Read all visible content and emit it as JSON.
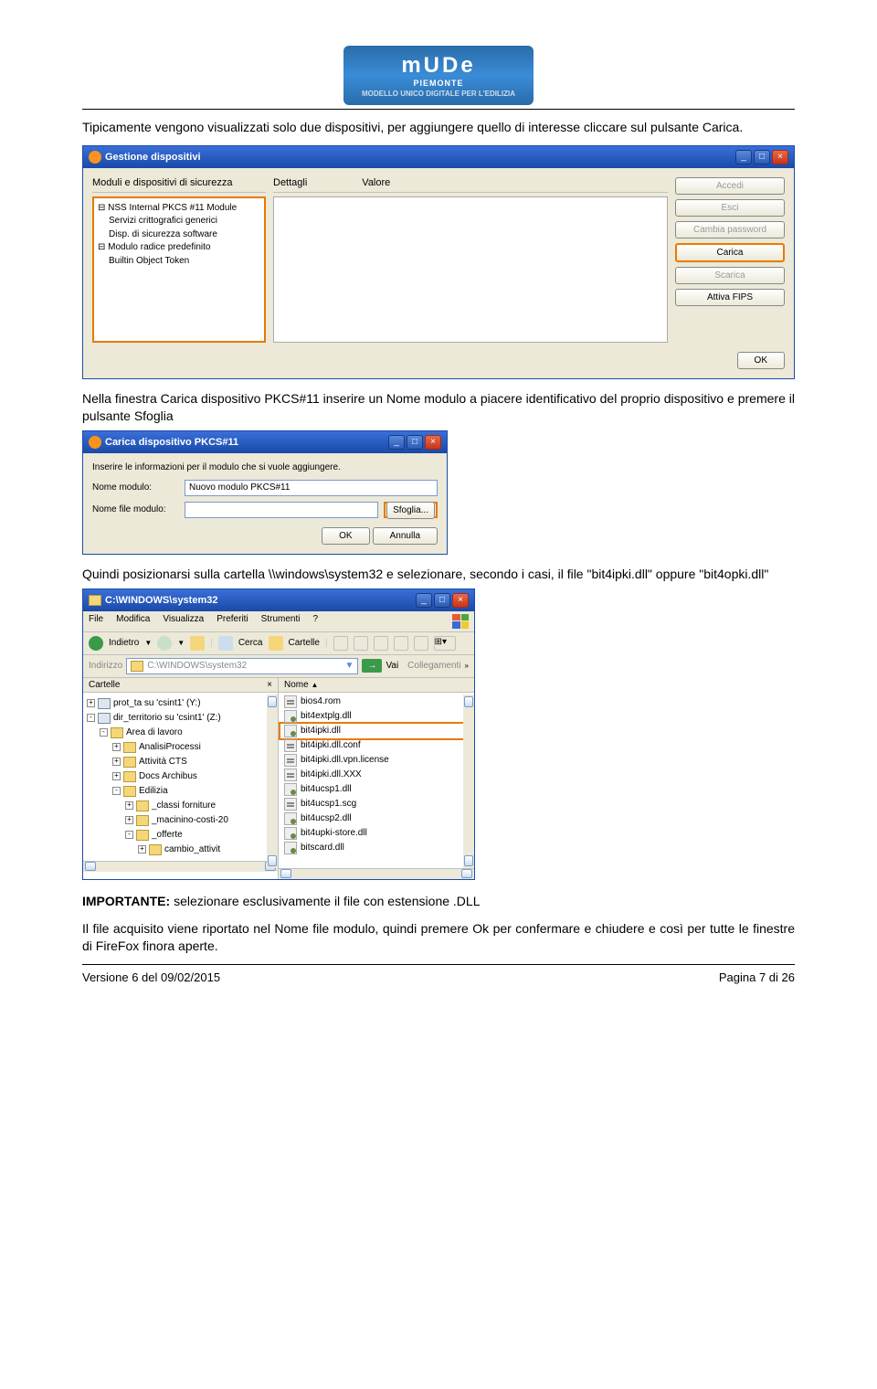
{
  "header": {
    "logo_main": "mUDe",
    "logo_sub": "PIEMONTE",
    "logo_tag": "MODELLO UNICO DIGITALE PER L'EDILIZIA"
  },
  "text1": "Tipicamente vengono visualizzati solo due dispositivi, per aggiungere quello di interesse cliccare sul pulsante Carica.",
  "win1": {
    "title": "Gestione dispositivi",
    "top_label": "Moduli e dispositivi di sicurezza",
    "columns": {
      "detail": "Dettagli",
      "value": "Valore"
    },
    "tree": [
      "⊟ NSS Internal PKCS #11 Module",
      "    Servizi crittografici generici",
      "    Disp. di sicurezza software",
      "⊟ Modulo radice predefinito",
      "    Builtin Object Token"
    ],
    "buttons": {
      "accedi": "Accedi",
      "esci": "Esci",
      "cambia": "Cambia password",
      "carica": "Carica",
      "scarica": "Scarica",
      "fips": "Attiva FIPS",
      "ok": "OK"
    }
  },
  "text2": "Nella finestra Carica dispositivo PKCS#11 inserire un Nome modulo a piacere identificativo del proprio dispositivo e premere il pulsante Sfoglia",
  "win2": {
    "title": "Carica dispositivo PKCS#11",
    "instruction": "Inserire le informazioni per il modulo che si vuole aggiungere.",
    "label_nome": "Nome modulo:",
    "value_nome": "Nuovo modulo PKCS#11",
    "label_file": "Nome file modulo:",
    "value_file": "",
    "sfoglia": "Sfoglia...",
    "ok": "OK",
    "annulla": "Annulla"
  },
  "text3": "Quindi posizionarsi sulla cartella \\\\windows\\system32 e selezionare, secondo i casi, il file \"bit4ipki.dll\" oppure \"bit4opki.dll\"",
  "win3": {
    "title": "C:\\WINDOWS\\system32",
    "menu": [
      "File",
      "Modifica",
      "Visualizza",
      "Preferiti",
      "Strumenti",
      "?"
    ],
    "toolbar": {
      "back": "Indietro",
      "search": "Cerca",
      "folders": "Cartelle"
    },
    "addr_label": "Indirizzo",
    "addr_value": "C:\\WINDOWS\\system32",
    "go": "Vai",
    "links": "Collegamenti",
    "side_title": "Cartelle",
    "side_close": "×",
    "tree": [
      {
        "indent": 0,
        "box": "+",
        "type": "drv",
        "label": "prot_ta su 'csint1' (Y:)"
      },
      {
        "indent": 0,
        "box": "-",
        "type": "drv",
        "label": "dir_territorio su 'csint1' (Z:)"
      },
      {
        "indent": 1,
        "box": "-",
        "type": "fld",
        "label": "Area di lavoro"
      },
      {
        "indent": 2,
        "box": "+",
        "type": "fld",
        "label": "AnalisiProcessi"
      },
      {
        "indent": 2,
        "box": "+",
        "type": "fld",
        "label": "Attività CTS"
      },
      {
        "indent": 2,
        "box": "+",
        "type": "fld",
        "label": "Docs Archibus"
      },
      {
        "indent": 2,
        "box": "-",
        "type": "fld",
        "label": "Edilizia"
      },
      {
        "indent": 3,
        "box": "+",
        "type": "fld",
        "label": "_classi forniture"
      },
      {
        "indent": 3,
        "box": "+",
        "type": "fld",
        "label": "_macinino-costi-20"
      },
      {
        "indent": 3,
        "box": "-",
        "type": "fld",
        "label": "_offerte"
      },
      {
        "indent": 4,
        "box": "+",
        "type": "fld",
        "label": "cambio_attivit"
      }
    ],
    "files_head": "Nome",
    "files": [
      {
        "icon": "txt",
        "name": "bios4.rom",
        "hl": false
      },
      {
        "icon": "gear",
        "name": "bit4extplg.dll",
        "hl": false
      },
      {
        "icon": "gear",
        "name": "bit4ipki.dll",
        "hl": true
      },
      {
        "icon": "txt",
        "name": "bit4ipki.dll.conf",
        "hl": false
      },
      {
        "icon": "txt",
        "name": "bit4ipki.dll.vpn.license",
        "hl": false
      },
      {
        "icon": "txt",
        "name": "bit4ipki.dll.XXX",
        "hl": false
      },
      {
        "icon": "gear",
        "name": "bit4ucsp1.dll",
        "hl": false
      },
      {
        "icon": "txt",
        "name": "bit4ucsp1.scg",
        "hl": false
      },
      {
        "icon": "gear",
        "name": "bit4ucsp2.dll",
        "hl": false
      },
      {
        "icon": "gear",
        "name": "bit4upki-store.dll",
        "hl": false
      },
      {
        "icon": "gear",
        "name": "bitscard.dll",
        "hl": false
      }
    ]
  },
  "text4a": "IMPORTANTE:",
  "text4b": " selezionare esclusivamente il file con estensione .DLL",
  "text5": "Il file acquisito viene riportato nel Nome file modulo, quindi premere Ok per confermare e chiudere e così per tutte le finestre di FireFox finora aperte.",
  "footer": {
    "version": "Versione 6 del 09/02/2015",
    "page": "Pagina 7 di 26"
  }
}
